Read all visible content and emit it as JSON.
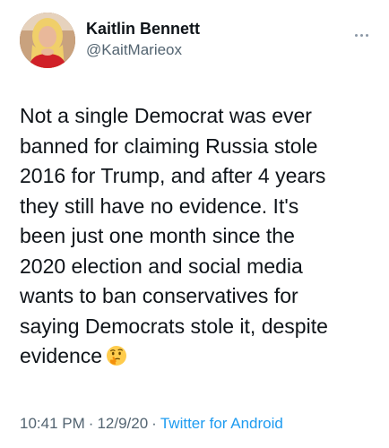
{
  "user": {
    "display_name": "Kaitlin Bennett",
    "handle": "@KaitMarieox"
  },
  "tweet": {
    "text": "Not a single Democrat was ever\nbanned for claiming Russia stole\n2016 for Trump, and after 4 years\nthey still have no evidence. It's\nbeen just one month since the\n2020 election and social media\nwants to ban conservatives for\nsaying Democrats stole it, despite\nevidence",
    "emoji": "thinking-face-emoji"
  },
  "meta": {
    "time": "10:41 PM",
    "separator": "·",
    "date": "12/9/20",
    "source": "Twitter for Android"
  },
  "icons": {
    "more": "more-horizontal-icon",
    "avatar": "user-avatar"
  },
  "colors": {
    "text_primary": "#0f1419",
    "text_secondary": "#536471",
    "accent": "#1d9bf0"
  }
}
